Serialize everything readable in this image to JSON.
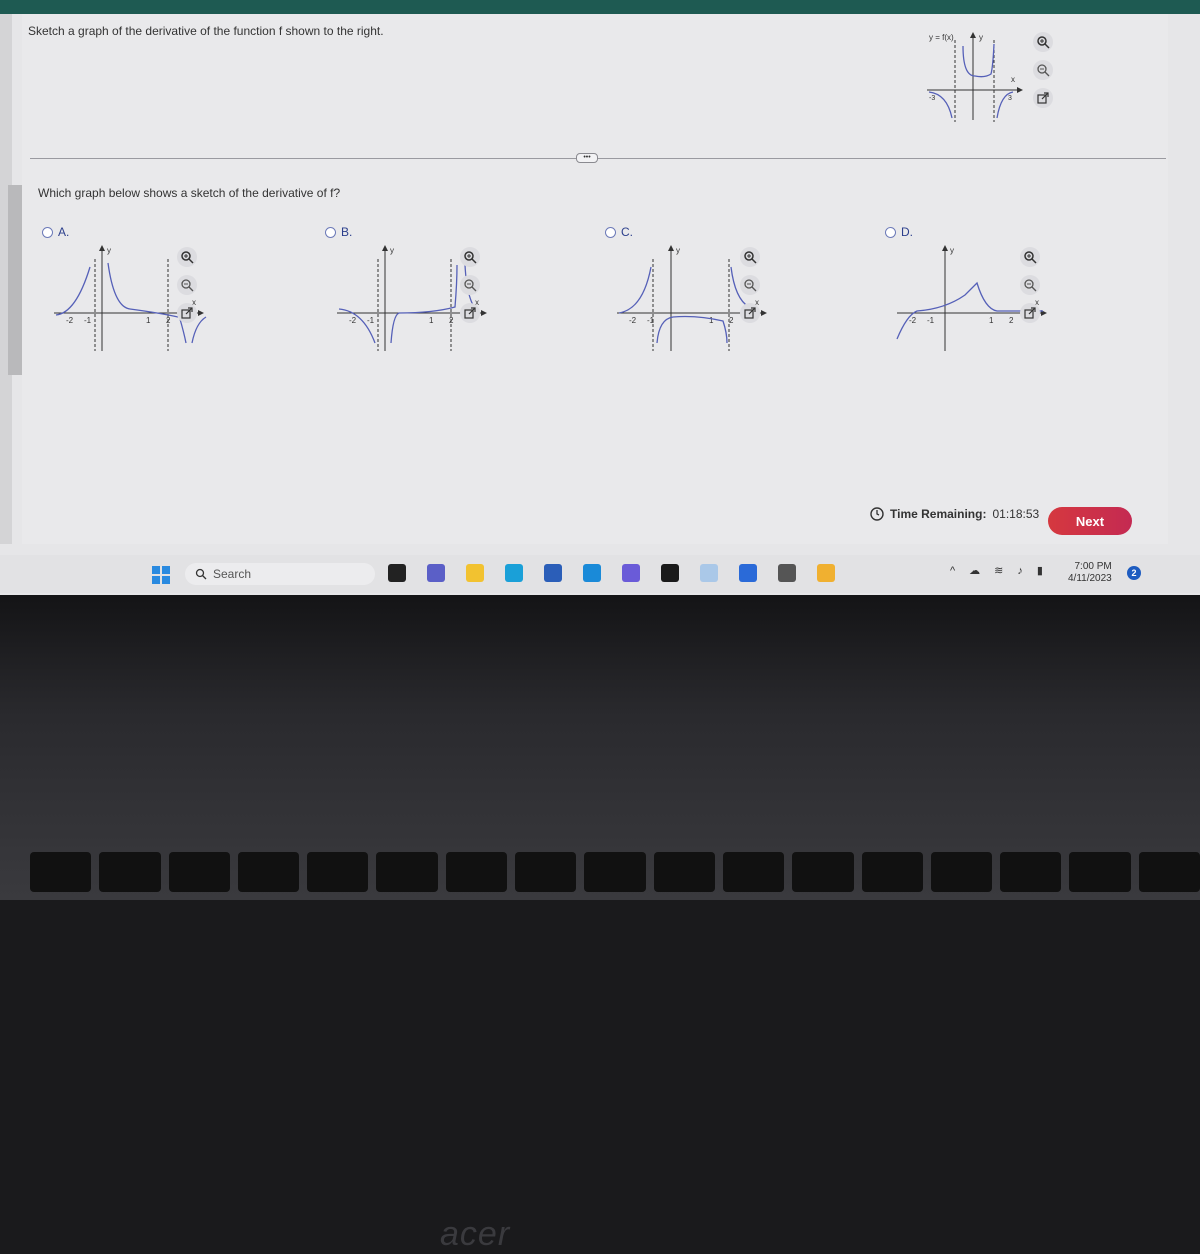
{
  "question": {
    "prompt": "Sketch a graph of the derivative of the function f shown to the right.",
    "sub_prompt": "Which graph below shows a sketch of the derivative of f?",
    "given_graph": {
      "label": "y = f(x)",
      "x_axis": "x",
      "y_axis": "y",
      "tick_labels": [
        "-3",
        "3"
      ]
    }
  },
  "options": [
    {
      "letter": "A.",
      "x_ticks": [
        "-2",
        "-1",
        "1",
        "2"
      ],
      "x_axis": "x",
      "y_axis": "y"
    },
    {
      "letter": "B.",
      "x_ticks": [
        "-2",
        "-1",
        "1",
        "2"
      ],
      "x_axis": "x",
      "y_axis": "y"
    },
    {
      "letter": "C.",
      "x_ticks": [
        "-2",
        "-1",
        "1",
        "2"
      ],
      "x_axis": "x",
      "y_axis": "y"
    },
    {
      "letter": "D.",
      "x_ticks": [
        "-2",
        "-1",
        "1",
        "2"
      ],
      "x_axis": "x",
      "y_axis": "y"
    }
  ],
  "tools": {
    "zoom_in": "zoom-in",
    "zoom_out": "zoom-out",
    "popout": "open-in-new-window"
  },
  "separator": {
    "label": "•••"
  },
  "footer": {
    "timer_label": "Time Remaining:",
    "timer_value": "01:18:53",
    "next_label": "Next"
  },
  "taskbar": {
    "search_placeholder": "Search",
    "apps": [
      "task-view",
      "teams-chat",
      "file-explorer",
      "edge",
      "word",
      "mail",
      "copilot",
      "dropbox",
      "amazon",
      "microsoft-store",
      "app-figure",
      "app-hex"
    ],
    "clock_time": "7:00 PM",
    "clock_date": "4/11/2023",
    "notification_count": "2"
  },
  "bezel": {
    "brand": "acer"
  }
}
